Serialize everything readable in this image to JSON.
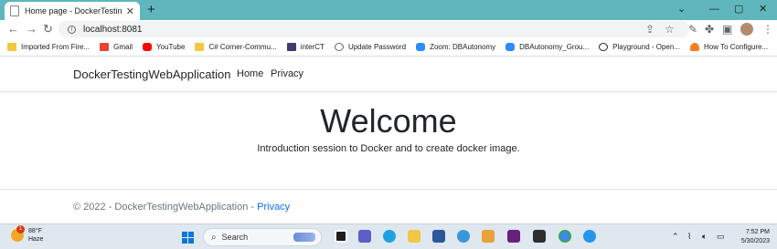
{
  "browser": {
    "tab_title": "Home page - DockerTestingWebApplication",
    "url": "localhost:8081",
    "bookmarks": [
      {
        "label": "Imported From Fire...",
        "icon": "folder-icon",
        "color": "#f2c744"
      },
      {
        "label": "Gmail",
        "icon": "gmail-icon",
        "color": "#ea4335"
      },
      {
        "label": "YouTube",
        "icon": "youtube-icon",
        "color": "#ff0000"
      },
      {
        "label": "C# Corner-Commu...",
        "icon": "folder-icon",
        "color": "#f2c744"
      },
      {
        "label": "interCT",
        "icon": "intercom-icon",
        "color": "#3c3c6e"
      },
      {
        "label": "Update Password",
        "icon": "globe-icon",
        "color": "#5f6368"
      },
      {
        "label": "Zoom: DBAutonomy",
        "icon": "zoom-icon",
        "color": "#2d8cff"
      },
      {
        "label": "DBAutonomy_Grou...",
        "icon": "zoom-icon",
        "color": "#2d8cff"
      },
      {
        "label": "Playground - Open...",
        "icon": "openai-icon",
        "color": "#202124"
      },
      {
        "label": "How To Configure...",
        "icon": "cloud-icon",
        "color": "#f38020"
      }
    ]
  },
  "site": {
    "brand": "DockerTestingWebApplication",
    "nav": {
      "home": "Home",
      "privacy": "Privacy"
    },
    "hero_title": "Welcome",
    "hero_text": "Introduction session to Docker and to create docker image.",
    "footer_text": "© 2022 - DockerTestingWebApplication - ",
    "footer_link": "Privacy"
  },
  "taskbar": {
    "weather_temp": "88°F",
    "weather_desc": "Haze",
    "weather_badge": "1",
    "search_placeholder": "Search",
    "time": "7:52 PM",
    "date": "5/30/2023",
    "accent_color": "#0a78d4"
  }
}
